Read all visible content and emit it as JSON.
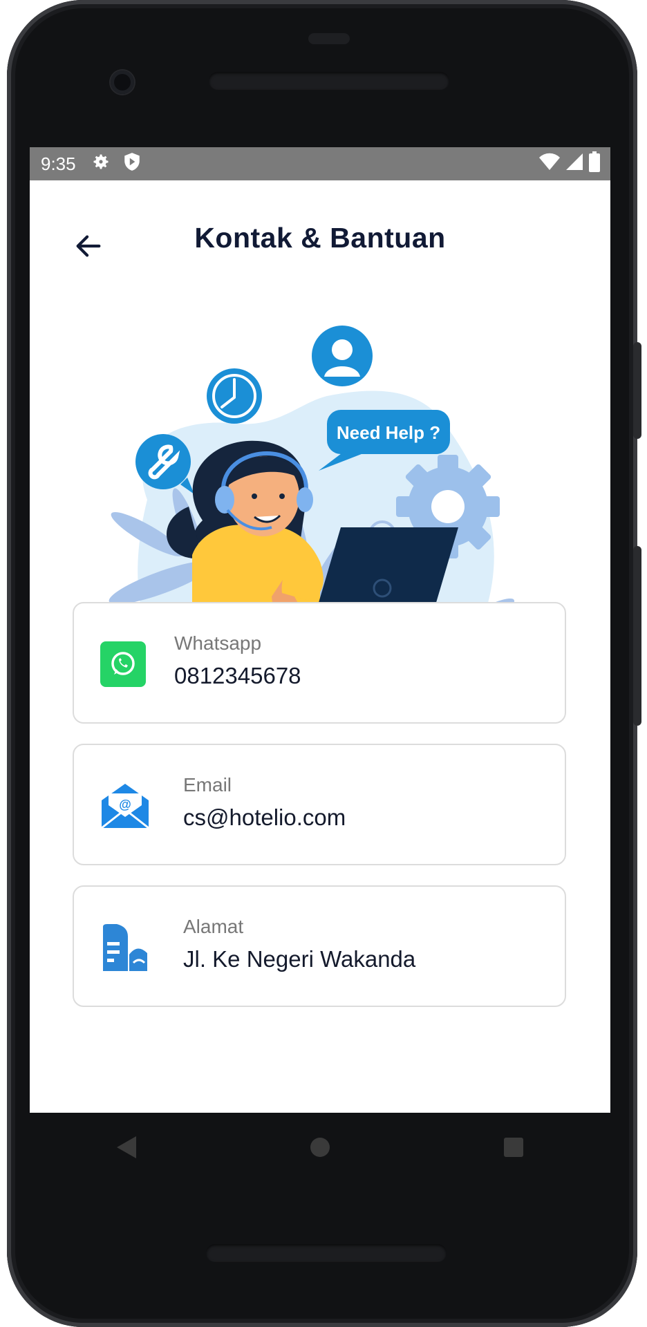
{
  "status_bar": {
    "time": "9:35",
    "left_icons": [
      "settings-icon",
      "shield-icon"
    ],
    "right_icons": [
      "wifi-icon",
      "signal-icon",
      "battery-icon"
    ]
  },
  "header": {
    "title": "Kontak & Bantuan",
    "back_icon": "arrow-left-icon"
  },
  "illustration": {
    "speech_bubble": "Need Help ?"
  },
  "contacts": [
    {
      "label": "Whatsapp",
      "value": "0812345678",
      "icon": "whatsapp-icon",
      "color": "#25D366"
    },
    {
      "label": "Email",
      "value": "cs@hotelio.com",
      "icon": "email-icon",
      "color": "#1E88E5"
    },
    {
      "label": "Alamat",
      "value": "Jl. Ke Negeri Wakanda",
      "icon": "building-icon",
      "color": "#2D86D6"
    }
  ],
  "nav_bar": {
    "icons": [
      "back-triangle-icon",
      "home-circle-icon",
      "recents-square-icon"
    ]
  },
  "colors": {
    "title": "#111A35",
    "status_bar": "#7B7B7B",
    "accent_blue": "#1B8FD6"
  }
}
